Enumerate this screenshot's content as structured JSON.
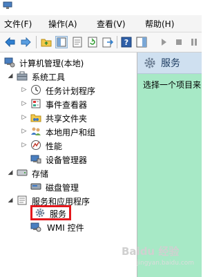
{
  "menubar": {
    "items": [
      "文件(F)",
      "操作(A)",
      "查看(V)",
      "帮助(H)"
    ]
  },
  "toolbar": {
    "buttons": [
      "back-icon",
      "forward-icon",
      "up-folder-icon",
      "show-tree-icon",
      "properties-icon",
      "refresh-icon",
      "export-icon",
      "help-icon",
      "action-pane-icon",
      "start-icon",
      "stop-icon",
      "pause-icon"
    ]
  },
  "tree": {
    "root": "计算机管理(本地)",
    "system_tools": "系统工具",
    "task_scheduler": "任务计划程序",
    "event_viewer": "事件查看器",
    "shared_folders": "共享文件夹",
    "local_users": "本地用户和组",
    "performance": "性能",
    "device_manager": "设备管理器",
    "storage": "存储",
    "disk_management": "磁盘管理",
    "services_apps": "服务和应用程序",
    "services": "服务",
    "wmi": "WMI 控件"
  },
  "right_pane": {
    "title": "服务",
    "description": "选择一个项目来"
  },
  "watermark": {
    "text": "Bai⁠du 经验",
    "sub": "jingyan.baidu.com"
  },
  "colors": {
    "highlight": "#e3171c",
    "right_pane_bg": "#a7e9c6",
    "header_bg": "#cfe0f0"
  }
}
